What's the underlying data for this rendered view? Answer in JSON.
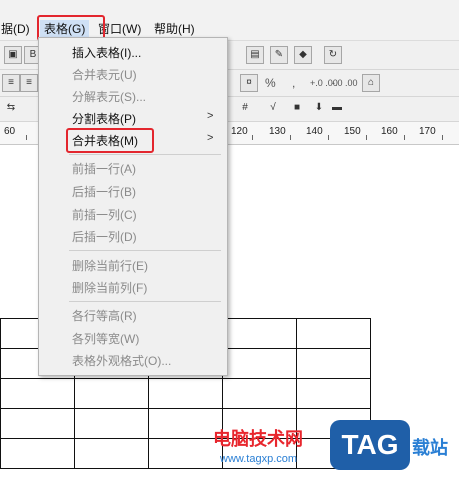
{
  "menubar": {
    "items": [
      "据(D)",
      "表格(G)",
      "窗口(W)",
      "帮助(H)"
    ]
  },
  "toolbar": {
    "symbols": [
      "%",
      ",",
      "+.0 .00",
      "-.0 .00"
    ]
  },
  "ruler": {
    "left_label": "60",
    "labels": [
      "120",
      "130",
      "140",
      "150",
      "160",
      "170"
    ]
  },
  "dropdown": {
    "items": [
      {
        "label": "插入表格(I)...",
        "enabled": true,
        "submenu": false
      },
      {
        "label": "合并表元(U)",
        "enabled": false,
        "submenu": false
      },
      {
        "label": "分解表元(S)...",
        "enabled": false,
        "submenu": false
      },
      {
        "label": "分割表格(P)",
        "enabled": true,
        "submenu": true
      },
      {
        "label": "合并表格(M)",
        "enabled": true,
        "submenu": true
      },
      {
        "label": "前插一行(A)",
        "enabled": false,
        "submenu": false
      },
      {
        "label": "后插一行(B)",
        "enabled": false,
        "submenu": false
      },
      {
        "label": "前插一列(C)",
        "enabled": false,
        "submenu": false
      },
      {
        "label": "后插一列(D)",
        "enabled": false,
        "submenu": false
      },
      {
        "label": "删除当前行(E)",
        "enabled": false,
        "submenu": false
      },
      {
        "label": "删除当前列(F)",
        "enabled": false,
        "submenu": false
      },
      {
        "label": "各行等高(R)",
        "enabled": false,
        "submenu": false
      },
      {
        "label": "各列等宽(W)",
        "enabled": false,
        "submenu": false
      },
      {
        "label": "表格外观格式(O)...",
        "enabled": false,
        "submenu": false
      }
    ]
  },
  "watermark": {
    "text_cn": "电脑技术网",
    "url": "www.tagxp.com",
    "badge": "TAG",
    "suffix": "载站"
  },
  "colors": {
    "highlight_red": "#e3262e",
    "menu_bg": "#f0f0f0"
  }
}
